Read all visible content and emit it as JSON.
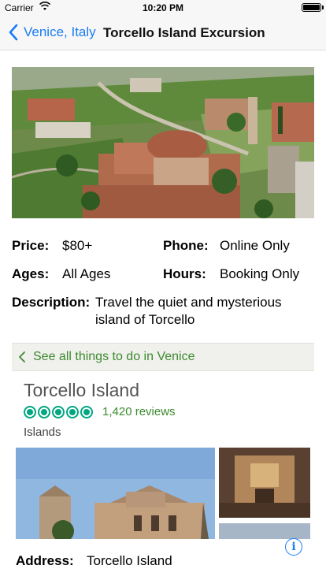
{
  "status_bar": {
    "carrier": "Carrier",
    "time": "10:20 PM"
  },
  "nav": {
    "back_label": "Venice, Italy",
    "title": "Torcello Island Excursion"
  },
  "details": {
    "price_label": "Price:",
    "price_value": "$80+",
    "phone_label": "Phone:",
    "phone_value": "Online Only",
    "ages_label": "Ages:",
    "ages_value": "All Ages",
    "hours_label": "Hours:",
    "hours_value": "Booking Only",
    "description_label": "Description:",
    "description_line1": "Travel the quiet and mysterious",
    "description_line2": "island of Torcello"
  },
  "see_all": {
    "label": "See all things to do in Venice"
  },
  "place": {
    "name": "Torcello Island",
    "rating_bubbles": 5,
    "reviews": "1,420 reviews",
    "category": "Islands",
    "address_label": "Address:",
    "address_value": "Torcello Island"
  },
  "colors": {
    "ios_blue": "#1a7cf5",
    "tripadvisor_green": "#00a680",
    "link_green": "#3c8a2e"
  },
  "icons": {
    "back": "chevron-left-icon",
    "see_all": "chevron-left-icon",
    "info": "info-icon",
    "wifi": "wifi-icon",
    "battery": "battery-icon"
  }
}
